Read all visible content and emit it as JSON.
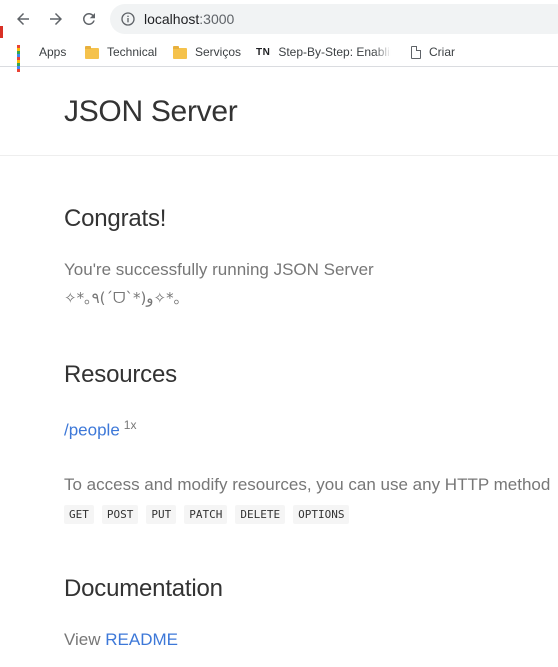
{
  "browser": {
    "url_host": "localhost",
    "url_port": ":3000",
    "bookmarks": [
      {
        "label": "Apps",
        "icon": "apps-grid-icon"
      },
      {
        "label": "Technical",
        "icon": "folder-icon"
      },
      {
        "label": "Serviços",
        "icon": "folder-icon"
      },
      {
        "label": "Step-By-Step: Enablin",
        "icon": "tn-favicon",
        "badge": "TN"
      },
      {
        "label": "Criar",
        "icon": "document-icon"
      }
    ]
  },
  "page": {
    "site_title": "JSON Server",
    "congrats": {
      "heading": "Congrats!",
      "line1": "You're successfully running JSON Server",
      "line2": "✧*｡٩(ˊᗜˋ*)و✧*｡"
    },
    "resources": {
      "heading": "Resources",
      "link": "/people",
      "count": "1x",
      "access_text": "To access and modify resources, you can use any HTTP method",
      "methods": [
        "GET",
        "POST",
        "PUT",
        "PATCH",
        "DELETE",
        "OPTIONS"
      ]
    },
    "documentation": {
      "heading": "Documentation",
      "view_text": "View",
      "readme_link": "README"
    }
  },
  "colors": {
    "link": "#3d78d8",
    "text_muted": "#777777",
    "heading": "#333333"
  }
}
